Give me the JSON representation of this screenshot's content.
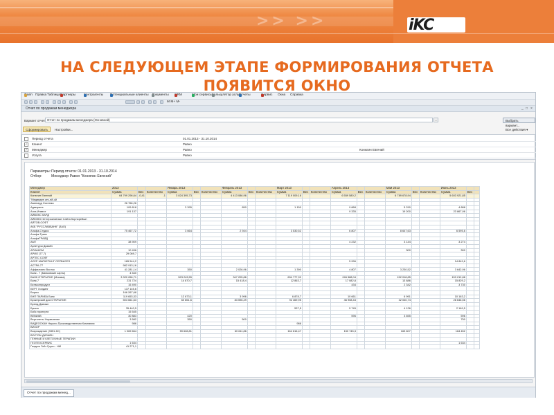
{
  "brand": {
    "logo_text": "iKC",
    "banner_color": "#e8732c",
    "heading_color": "#e66a1f"
  },
  "slide": {
    "heading_line1": "НА СЛЕДУЮЩЕМ ЭТАПЕ ФОРМИРОВАНИЯ ОТЧЕТА",
    "heading_line2": "ПОЯВИТСЯ ОКНО"
  },
  "app": {
    "menu": [
      {
        "label": "Файл",
        "icon": "file-icon"
      },
      {
        "label": "Правка",
        "icon": ""
      },
      {
        "label": "Таблица",
        "icon": ""
      },
      {
        "label": "Партнеры",
        "icon": "partners-icon"
      },
      {
        "label": "Контрагенты",
        "icon": "contractors-icon"
      },
      {
        "label": "Потенциальные клиенты",
        "icon": "potential-clients-icon"
      },
      {
        "label": "Документы",
        "icon": "documents-icon"
      },
      {
        "label": "CRM",
        "icon": "crm-icon"
      },
      {
        "label": "Мои сервисы",
        "icon": "services-icon"
      },
      {
        "label": "Калькулятор услуг",
        "icon": "calculator-icon"
      },
      {
        "label": "Отчеты",
        "icon": "reports-icon"
      },
      {
        "label": "Сервис",
        "icon": "service-icon"
      },
      {
        "label": "Окна",
        "icon": ""
      },
      {
        "label": "Справка",
        "icon": ""
      }
    ],
    "toolbar_text": "M  M+  M-",
    "document_title": "Отчет по продажам менеджера",
    "variant_label": "Вариант отчета:",
    "variant_value": "Отчет по продажам менеджера (Основной)",
    "choose_variant_button": "Выбрать вариант...",
    "generate_button": "Сформировать",
    "settings_button": "Настройки...",
    "all_actions": "Все действия ▾",
    "filters": [
      {
        "checked": false,
        "name": "Период отчета",
        "condition": "01.01.2013 - 31.10.2014",
        "value": ""
      },
      {
        "checked": true,
        "name": "Клиент",
        "condition": "Равно",
        "value": ""
      },
      {
        "checked": true,
        "name": "Менеджер",
        "condition": "Равно",
        "value": "Конюгин Евгений"
      },
      {
        "checked": false,
        "name": "Услуга",
        "condition": "Равно",
        "value": ""
      }
    ],
    "report": {
      "params_label": "Параметры:",
      "params_value": "Период отчета: 01.01.2013 - 31.10.2014",
      "filter_label": "Отбор:",
      "filter_value": "Менеджер Равно \"Конюгин Евгений\"",
      "header_row1": [
        "Менеджер",
        "2013",
        "",
        "",
        "Январь 2013",
        "",
        "",
        "Февраль 2013",
        "",
        "",
        "Март 2013",
        "",
        "",
        "Апрель 2013",
        "",
        "",
        "Май 2013",
        "",
        "",
        "Июнь 2013",
        "",
        ""
      ],
      "header_row2": [
        "Клиент",
        "Сумма",
        "Вес",
        "Количество",
        "Сумма",
        "Вес",
        "Количество",
        "Сумма",
        "Вес",
        "Количество",
        "Сумма",
        "Вес",
        "Количество",
        "Сумма",
        "Вес",
        "Количество",
        "Сумма",
        "Вес",
        "Количество",
        "Сумма",
        "Вес",
        ""
      ],
      "total_row": [
        "Конюгин Евгений",
        "64 799 296,64",
        "-0,41",
        "-1",
        "3 824 395,73",
        "",
        "",
        "4 413 086,96",
        "",
        "",
        "7 119 009,16",
        "",
        "",
        "6 559 580,2",
        "",
        "",
        "6 789 678,94",
        "",
        "",
        "5 603 921,85",
        "",
        ""
      ],
      "rows": [
        [
          "\"Медведев сеч-ей-ой",
          "",
          "",
          "",
          "",
          "",
          "",
          "",
          "",
          "",
          "",
          "",
          "",
          "",
          "",
          "",
          "",
          "",
          "",
          "",
          "",
          ""
        ],
        [
          "Авангард Система",
          "26 766,26",
          "",
          "",
          "",
          "",
          "",
          "",
          "",
          "",
          "",
          "",
          "",
          "",
          "",
          "",
          "",
          "",
          "",
          "",
          "",
          ""
        ],
        [
          "Адмиралъ",
          "109 818",
          "",
          "",
          "3 395",
          "",
          "",
          "850",
          "",
          "",
          "1 150",
          "",
          "",
          "9 868",
          "",
          "",
          "5 290",
          "",
          "",
          "4 888",
          "",
          ""
        ],
        [
          "Алга-Инвест",
          "191 137",
          "",
          "",
          "",
          "",
          "",
          "",
          "",
          "",
          "",
          "",
          "",
          "9 335",
          "",
          "",
          "19 200",
          "",
          "",
          "23 867,96",
          "",
          ""
        ],
        [
          "АЙВОКС КАРД",
          "",
          "",
          "",
          "",
          "",
          "",
          "",
          "",
          "",
          "",
          "",
          "",
          "",
          "",
          "",
          "",
          "",
          "",
          "",
          "",
          ""
        ],
        [
          "АЙМЭКС Интерактивные Сайта Корпорейшн",
          "",
          "",
          "",
          "",
          "",
          "",
          "",
          "",
          "",
          "",
          "",
          "",
          "",
          "",
          "",
          "",
          "",
          "",
          "",
          "",
          ""
        ],
        [
          "АЙТОВ-СОФТ",
          "",
          "",
          "",
          "",
          "",
          "",
          "",
          "",
          "",
          "",
          "",
          "",
          "",
          "",
          "",
          "",
          "",
          "",
          "",
          "",
          ""
        ],
        [
          "АКБ \"РУССЛАВБАНК\" (ЗАО)",
          "",
          "",
          "",
          "",
          "",
          "",
          "",
          "",
          "",
          "",
          "",
          "",
          "",
          "",
          "",
          "",
          "",
          "",
          "",
          "",
          ""
        ],
        [
          "Альфа-Студио",
          "75 467,72",
          "",
          "",
          "3 664",
          "",
          "",
          "2 944",
          "",
          "",
          "3 530,52",
          "",
          "",
          "6 807",
          "",
          "",
          "8 647,63",
          "",
          "",
          "6 595,6",
          "",
          ""
        ],
        [
          "Альфа-Транс",
          "",
          "",
          "",
          "",
          "",
          "",
          "",
          "",
          "",
          "",
          "",
          "",
          "",
          "",
          "",
          "",
          "",
          "",
          "",
          "",
          ""
        ],
        [
          "АльфаТРАЙД",
          "",
          "",
          "",
          "",
          "",
          "",
          "",
          "",
          "",
          "",
          "",
          "",
          "",
          "",
          "",
          "",
          "",
          "",
          "",
          "",
          ""
        ],
        [
          "АМТ",
          "38 909",
          "",
          "",
          "",
          "",
          "",
          "",
          "",
          "",
          "",
          "",
          "",
          "4 232",
          "",
          "",
          "3 144",
          "",
          "",
          "3 274",
          "",
          ""
        ],
        [
          "Арлетуры Дизайн",
          "",
          "",
          "",
          "",
          "",
          "",
          "",
          "",
          "",
          "",
          "",
          "",
          "",
          "",
          "",
          "",
          "",
          "",
          "",
          "",
          ""
        ],
        [
          "АРИАКОМ",
          "10 496",
          "",
          "",
          "",
          "",
          "",
          "",
          "",
          "",
          "",
          "",
          "",
          "",
          "",
          "",
          "300",
          "",
          "",
          "300",
          "",
          ""
        ],
        [
          "АРИО (77,7)",
          "29 069,7",
          "",
          "",
          "",
          "",
          "",
          "",
          "",
          "",
          "",
          "",
          "",
          "",
          "",
          "",
          "",
          "",
          "",
          "",
          "",
          ""
        ],
        [
          "АРТЕС СОФТ",
          "",
          "",
          "",
          "",
          "",
          "",
          "",
          "",
          "",
          "",
          "",
          "",
          "",
          "",
          "",
          "",
          "",
          "",
          "",
          "",
          ""
        ],
        [
          "АСЕР МАРКЕТИНГ СЕРВИСЕЗ",
          "165 544,2",
          "",
          "",
          "",
          "",
          "",
          "",
          "",
          "",
          "",
          "",
          "",
          "5 996",
          "",
          "",
          "",
          "",
          "",
          "14 849,6",
          "",
          ""
        ],
        [
          "АСТРА-77",
          "982 913,16",
          "",
          "",
          "",
          "",
          "",
          "",
          "",
          "",
          "",
          "",
          "",
          "",
          "",
          "",
          "",
          "",
          "",
          "",
          "",
          ""
        ],
        [
          "Аффилиатс Восток",
          "41 281,14",
          "",
          "",
          "350",
          "",
          "",
          "2 026,96",
          "",
          "",
          "1 390",
          "",
          "",
          "4 807",
          "",
          "",
          "3 230,52",
          "",
          "",
          "3 642,96",
          "",
          ""
        ],
        [
          "Банк - 7 (Банковские карты)",
          "4 540",
          "",
          "",
          "",
          "",
          "",
          "",
          "",
          "",
          "",
          "",
          "",
          "",
          "",
          "",
          "",
          "",
          "",
          "",
          "",
          ""
        ],
        [
          "БАНК ОТКРЫТИЕ (Москва)",
          "3 320 266,71",
          "",
          "",
          "523 243,55",
          "",
          "",
          "347 205,86",
          "",
          "",
          "634 777,92",
          "",
          "",
          "246 588,04",
          "",
          "",
          "152 018,85",
          "",
          "",
          "153 212,88",
          "",
          ""
        ],
        [
          "Банк-7",
          "231 724",
          "",
          "",
          "14 870,7",
          "",
          "",
          "15 418,4",
          "",
          "",
          "12 863,7",
          "",
          "",
          "17 082,8",
          "",
          "",
          "13 886",
          "",
          "",
          "15 829,2",
          "",
          ""
        ],
        [
          "Белмолпродукт",
          "15 490",
          "",
          "",
          "",
          "",
          "",
          "",
          "",
          "",
          "",
          "",
          "",
          "434",
          "",
          "",
          "2 342",
          "",
          "",
          "3 730",
          "",
          ""
        ],
        [
          "БЕРГ Холдинг",
          "137 145,6",
          "",
          "",
          "",
          "",
          "",
          "",
          "",
          "",
          "",
          "",
          "",
          "",
          "",
          "",
          "",
          "",
          "",
          "",
          "",
          ""
        ],
        [
          "Бирюч",
          "166 267,68",
          "",
          "",
          "",
          "",
          "",
          "",
          "",
          "",
          "",
          "",
          "",
          "",
          "",
          "",
          "",
          "",
          "",
          "",
          "",
          ""
        ],
        [
          "БНП ПАРИБА Банк",
          "119 653,33",
          "",
          "",
          "12 673,1",
          "",
          "",
          "3 996",
          "",
          "",
          "6 878,7",
          "",
          "",
          "10 661",
          "",
          "",
          "6 991",
          "",
          "",
          "10 163,2",
          "",
          ""
        ],
        [
          "Брокерский дом ОТКРЫТИЕ",
          "503 661,63",
          "",
          "",
          "60 851,6",
          "",
          "",
          "83 596,49",
          "",
          "",
          "92 469,95",
          "",
          "",
          "46 908,43",
          "",
          "",
          "32 040,74",
          "",
          "",
          "28 646,56",
          "",
          ""
        ],
        [
          "Бренд-Дивижн",
          "",
          "",
          "",
          "",
          "",
          "",
          "",
          "",
          "",
          "",
          "",
          "",
          "",
          "",
          "",
          "",
          "",
          "",
          "",
          "",
          ""
        ],
        [
          "Бушин",
          "35 440,5",
          "",
          "",
          "",
          "",
          "",
          "",
          "",
          "",
          "537,5",
          "",
          "",
          "5 745",
          "",
          "",
          "4 126",
          "",
          "",
          "2 169,5",
          "",
          ""
        ],
        [
          "Бэйс проперти",
          "15 545",
          "",
          "",
          "",
          "",
          "",
          "",
          "",
          "",
          "",
          "",
          "",
          "",
          "",
          "",
          "",
          "",
          "",
          "",
          "",
          ""
        ],
        [
          "ВЕВИАВ",
          "30 883",
          "",
          "",
          "420",
          "",
          "",
          "",
          "",
          "",
          "",
          "",
          "",
          "596",
          "",
          "",
          "3 655",
          "",
          "",
          "596",
          "",
          ""
        ],
        [
          "Вертолеты Управление",
          "3 582",
          "",
          "",
          "350",
          "",
          "",
          "500",
          "",
          "",
          "",
          "",
          "",
          "",
          "",
          "",
          "",
          "",
          "",
          "750",
          "",
          ""
        ],
        [
          "ВИДЕОСКАН Научно-Производственная Компания",
          "986",
          "",
          "",
          "",
          "",
          "",
          "",
          "",
          "",
          "986",
          "",
          "",
          "",
          "",
          "",
          "",
          "",
          "",
          "",
          "",
          ""
        ],
        [
          "ВИЗОР",
          "",
          "",
          "",
          "",
          "",
          "",
          "",
          "",
          "",
          "",
          "",
          "",
          "",
          "",
          "",
          "",
          "",
          "",
          "",
          "",
          ""
        ],
        [
          "Возрождение (3351-КС)",
          "1 069 664",
          "",
          "",
          "59 628,81",
          "",
          "",
          "60 611,86",
          "",
          "",
          "164 616,47",
          "",
          "",
          "150 745,3",
          "",
          "",
          "163 607",
          "",
          "",
          "164 452",
          "",
          ""
        ],
        [
          "ВОСТОК-ДИЗАЙН",
          "",
          "",
          "",
          "",
          "",
          "",
          "",
          "",
          "",
          "",
          "",
          "",
          "",
          "",
          "",
          "",
          "",
          "",
          "",
          "",
          ""
        ],
        [
          "ГЕННЫЕ И КЛЕТОЧНЫЕ ТЕРАПИИ",
          "",
          "",
          "",
          "",
          "",
          "",
          "",
          "",
          "",
          "",
          "",
          "",
          "",
          "",
          "",
          "",
          "",
          "",
          "",
          "",
          ""
        ],
        [
          "ГЕОТЕХСЕРВИС",
          "1 634",
          "",
          "",
          "",
          "",
          "",
          "",
          "",
          "",
          "",
          "",
          "",
          "",
          "",
          "",
          "",
          "",
          "",
          "1 634",
          "",
          ""
        ],
        [
          "Гелдинг Гейт Групп - НМ",
          "41 271,1",
          "",
          "",
          "",
          "",
          "",
          "",
          "",
          "",
          "",
          "",
          "",
          "",
          "",
          "",
          "",
          "",
          "",
          "",
          "",
          ""
        ]
      ]
    },
    "status_tab": "Отчет по продажам менед..."
  }
}
